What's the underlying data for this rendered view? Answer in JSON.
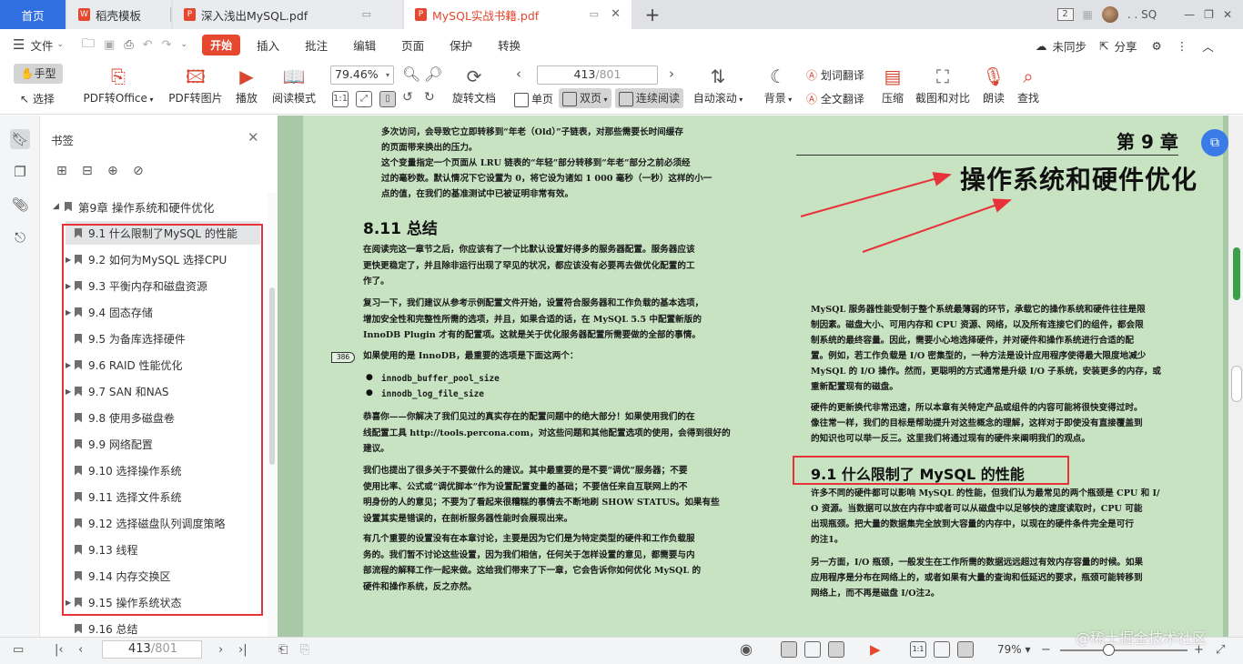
{
  "tabs": {
    "home": "首页",
    "t1": "稻壳模板",
    "t2": "深入浅出MySQL.pdf",
    "t3": "MySQL实战书籍.pdf",
    "window_count": "2",
    "user": ". . SQ"
  },
  "menu": {
    "file": "文件",
    "items": [
      "开始",
      "插入",
      "批注",
      "编辑",
      "页面",
      "保护",
      "转换"
    ],
    "sync": "未同步",
    "share": "分享"
  },
  "toolbar": {
    "hand": "手型",
    "select": "选择",
    "pdf_to_office": "PDF转Office",
    "pdf_to_image": "PDF转图片",
    "play": "播放",
    "read_mode": "阅读模式",
    "zoom": "79.46%",
    "rotate": "旋转文档",
    "page_current": "413",
    "page_total": "/801",
    "single": "单页",
    "double": "双页",
    "continuous": "连续阅读",
    "auto_scroll": "自动滚动",
    "background": "背景",
    "word_translate": "划词翻译",
    "full_translate": "全文翻译",
    "compress": "压缩",
    "screenshot": "截图和对比",
    "read_aloud": "朗读",
    "find": "查找"
  },
  "sidebar": {
    "title": "书签",
    "chapter": "第9章 操作系统和硬件优化",
    "items": [
      {
        "label": "9.1 什么限制了MySQL 的性能",
        "expand": ""
      },
      {
        "label": "9.2 如何为MySQL 选择CPU",
        "expand": "▶"
      },
      {
        "label": "9.3 平衡内存和磁盘资源",
        "expand": "▶"
      },
      {
        "label": "9.4 固态存储",
        "expand": "▶"
      },
      {
        "label": "9.5 为备库选择硬件",
        "expand": ""
      },
      {
        "label": "9.6 RAID 性能优化",
        "expand": "▶"
      },
      {
        "label": "9.7 SAN 和NAS",
        "expand": "▶"
      },
      {
        "label": "9.8 使用多磁盘卷",
        "expand": ""
      },
      {
        "label": "9.9 网络配置",
        "expand": ""
      },
      {
        "label": "9.10 选择操作系统",
        "expand": ""
      },
      {
        "label": "9.11 选择文件系统",
        "expand": ""
      },
      {
        "label": "9.12 选择磁盘队列调度策略",
        "expand": ""
      },
      {
        "label": "9.13 线程",
        "expand": ""
      },
      {
        "label": "9.14 内存交换区",
        "expand": ""
      },
      {
        "label": "9.15 操作系统状态",
        "expand": "▶"
      },
      {
        "label": "9.16 总结",
        "expand": ""
      }
    ]
  },
  "doc": {
    "left_top": [
      "多次访问，会导致它立即转移到“年老（Old）”子链表，对那些需要长时间缓存",
      "的页面带来换出的压力。",
      "这个变量指定一个页面从 LRU 链表的“年轻”部分转移到“年老”部分之前必须经",
      "过的毫秒数。默认情况下它设置为 0，将它设为诸如 1 000 毫秒（一秒）这样的小一",
      "点的值，在我们的基准测试中已被证明非常有效。"
    ],
    "sec811": "8.11  总结",
    "left_p1": [
      "在阅读完这一章节之后，你应该有了一个比默认设置好得多的服务器配置。服务器应该",
      "更快更稳定了，并且除非运行出现了罕见的状况，都应该没有必要再去做优化配置的工",
      "作了。"
    ],
    "left_p2": [
      "复习一下，我们建议从参考示例配置文件开始，设置符合服务器和工作负载的基本选项，",
      "增加安全性和完整性所需的选项，并且，如果合适的话，在 MySQL 5.5 中配置新版的",
      "InnoDB Plugin 才有的配置项。这就是关于优化服务器配置所需要做的全部的事情。"
    ],
    "margin_num": "386",
    "left_p3": "如果使用的是 InnoDB，最重要的选项是下面这两个：",
    "bullets": [
      "innodb_buffer_pool_size",
      "innodb_log_file_size"
    ],
    "left_p4": [
      "恭喜你——你解决了我们见过的真实存在的配置问题中的绝大部分！如果使用我们的在",
      "线配置工具 http://tools.percona.com，对这些问题和其他配置选项的使用，会得到很好的",
      "建议。"
    ],
    "left_p5": [
      "我们也提出了很多关于不要做什么的建议。其中最重要的是不要“调优”服务器；不要",
      "使用比率、公式或“调优脚本”作为设置配置变量的基础；不要信任来自互联网上的不",
      "明身份的人的意见；不要为了看起来很糟糕的事情去不断地刷 SHOW STATUS。如果有些",
      "设置其实是错误的，在剖析服务器性能时会展现出来。"
    ],
    "left_p6": [
      "有几个重要的设置没有在本章讨论，主要是因为它们是为特定类型的硬件和工作负载服",
      "务的。我们暂不讨论这些设置，因为我们相信，任何关于怎样设置的意见，都需要与内",
      "部流程的解释工作一起来做。这给我们带来了下一章，它会告诉你如何优化 MySQL 的",
      "硬件和操作系统，反之亦然。"
    ],
    "chap_label": "第 9 章",
    "chap_title": "操作系统和硬件优化",
    "right_p1": [
      "MySQL 服务器性能受制于整个系统最薄弱的环节，承载它的操作系统和硬件往往是限",
      "制因素。磁盘大小、可用内存和 CPU 资源、网络，以及所有连接它们的组件，都会限",
      "制系统的最终容量。因此，需要小心地选择硬件，并对硬件和操作系统进行合适的配",
      "置。例如，若工作负载是 I/O 密集型的，一种方法是设计应用程序使得最大限度地减少",
      "MySQL 的 I/O 操作。然而，更聪明的方式通常是升级 I/O 子系统，安装更多的内存，或",
      "重新配置现有的磁盘。"
    ],
    "right_p2": [
      "硬件的更新换代非常迅速，所以本章有关特定产品或组件的内容可能将很快变得过时。",
      "像往常一样，我们的目标是帮助提升对这些概念的理解，这样对于即使没有直接覆盖到",
      "的知识也可以举一反三。这里我们将通过现有的硬件来阐明我们的观点。"
    ],
    "sec91": "9.1  什么限制了 MySQL 的性能",
    "right_p3": [
      "许多不同的硬件都可以影响 MySQL 的性能，但我们认为最常见的两个瓶颈是 CPU 和 I/",
      "O 资源。当数据可以放在内存中或者可以从磁盘中以足够快的速度读取时，CPU 可能",
      "出现瓶颈。把大量的数据集完全放到大容量的内存中，以现在的硬件条件完全是可行",
      "的注1。"
    ],
    "right_p4": [
      "另一方面，I/O 瓶颈，一般发生在工作所需的数据远远超过有效内存容量的时候。如果",
      "应用程序是分布在网络上的，或者如果有大量的查询和低延迟的要求，瓶颈可能转移到",
      "网络上，而不再是磁盘 I/O注2。"
    ]
  },
  "status": {
    "page_current": "413",
    "page_total": "/801",
    "zoom": "79%",
    "watermark": "@稀土掘金技术社区"
  },
  "colors": {
    "accent": "#e5472f",
    "home_tab": "#2f6fe0",
    "page_bg": "#c7e3c1",
    "highlight_box": "#e8323a",
    "arrow": "#e8323a"
  }
}
